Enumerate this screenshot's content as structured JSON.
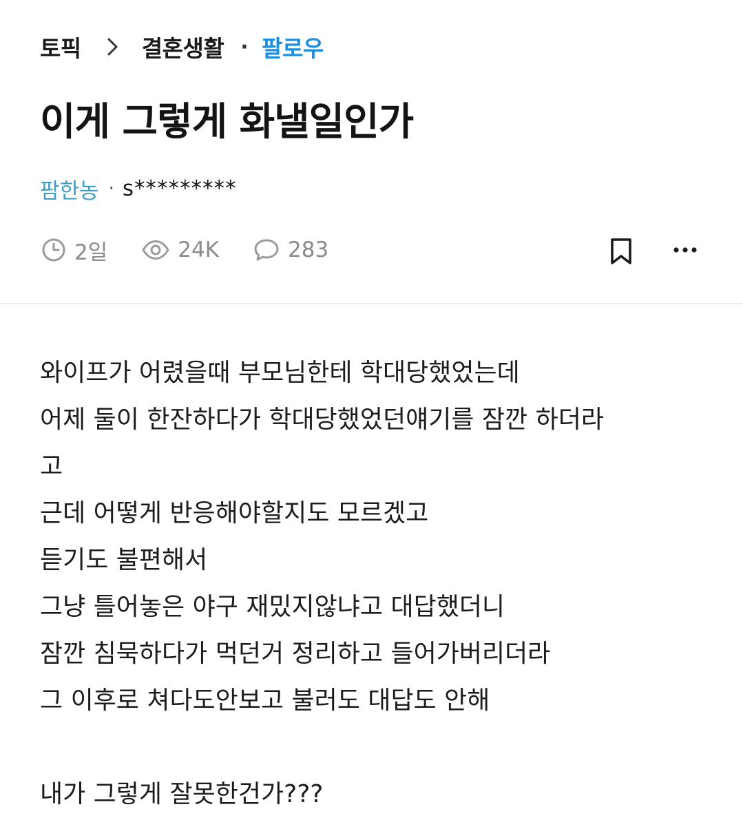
{
  "breadcrumb": {
    "root": "토픽",
    "category": "결혼생활",
    "separator": "·",
    "follow_label": "팔로우"
  },
  "post": {
    "title": "이게 그렇게 화낼일인가",
    "channel": "팜한농",
    "separator": "·",
    "author": "s*********",
    "time": "2일",
    "views": "24K",
    "comments": "283",
    "body_lines": [
      "와이프가 어렸을때 부모님한테 학대당했었는데",
      "어제 둘이 한잔하다가 학대당했었던얘기를 잠깐 하더라",
      "고",
      "근데 어떻게 반응해야할지도 모르겠고",
      "듣기도 불편해서",
      "그냥 틀어놓은 야구 재밌지않냐고 대답했더니",
      "잠깐 침묵하다가 먹던거 정리하고 들어가버리더라",
      "그 이후로 쳐다도안보고 불러도 대답도 안해",
      "",
      "내가 그렇게 잘못한건가???"
    ]
  },
  "icons": {
    "chevron": "chevron-right-icon",
    "time": "clock-icon",
    "views": "eye-icon",
    "comments": "comment-bubble-icon",
    "bookmark": "bookmark-icon",
    "more": "more-horizontal-icon"
  },
  "colors": {
    "follow": "#1b8ee0",
    "channel": "#3d9fc6",
    "meta": "#8a8a8a",
    "text": "#1a1a1a"
  }
}
